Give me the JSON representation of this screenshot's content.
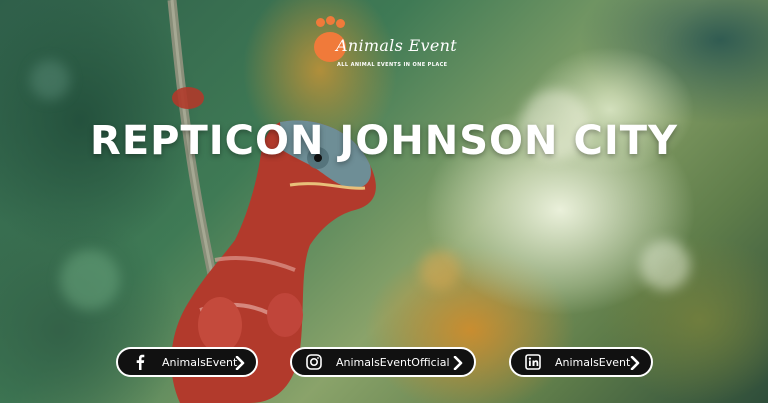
{
  "logo": {
    "title": "Animals Event",
    "tagline": "ALL ANIMAL EVENTS IN ONE PLACE",
    "icon": "paw-icon"
  },
  "headline": "REPTICON JOHNSON CITY",
  "socials": [
    {
      "network": "facebook",
      "icon": "facebook-icon",
      "label": "AnimalsEvent"
    },
    {
      "network": "instagram",
      "icon": "instagram-icon",
      "label": "AnimalsEventOfficial"
    },
    {
      "network": "linkedin",
      "icon": "linkedin-icon",
      "label": "AnimalsEvent"
    }
  ],
  "colors": {
    "accent": "#f07a3a",
    "pill_background": "#111111",
    "text": "#ffffff"
  }
}
